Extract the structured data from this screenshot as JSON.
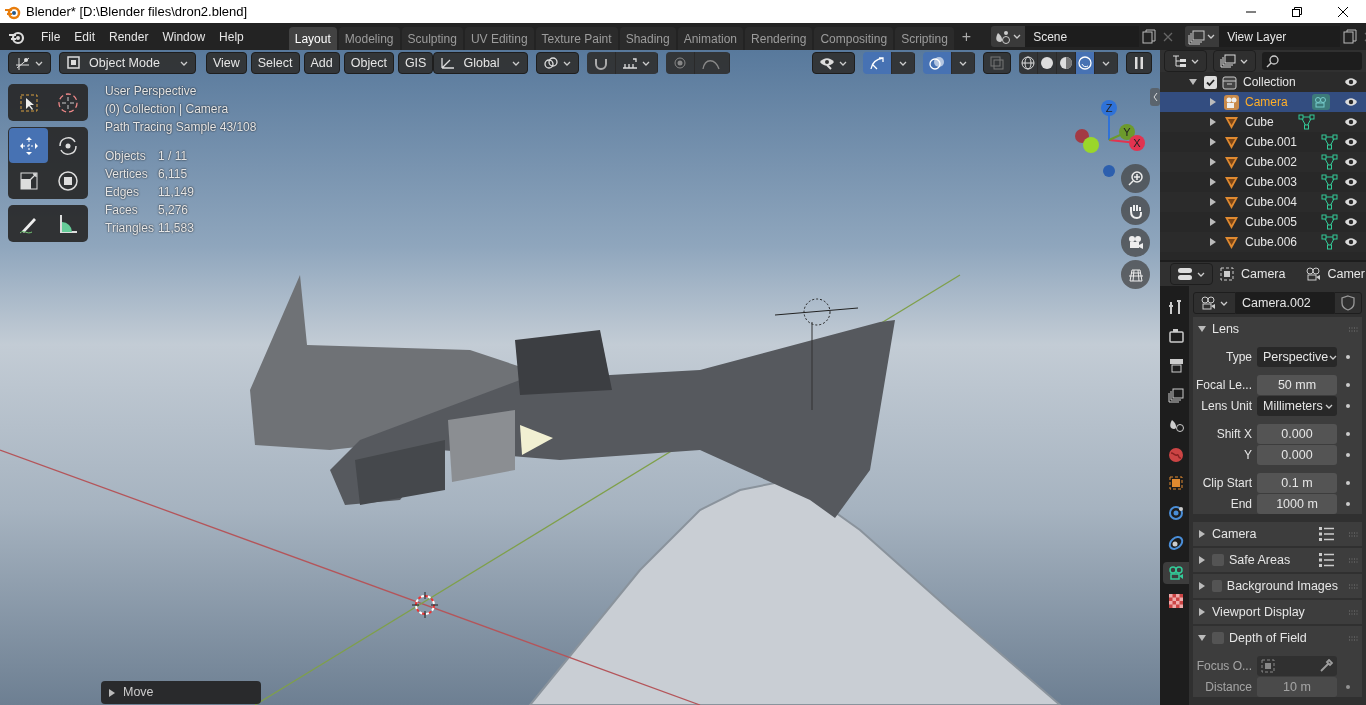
{
  "window": {
    "title": "Blender* [D:\\Blender files\\dron2.blend]"
  },
  "menu": [
    "File",
    "Edit",
    "Render",
    "Window",
    "Help"
  ],
  "workspaces": [
    {
      "label": "Layout",
      "selected": true
    },
    {
      "label": "Modeling",
      "selected": false
    },
    {
      "label": "Sculpting",
      "selected": false
    },
    {
      "label": "UV Editing",
      "selected": false
    },
    {
      "label": "Texture Paint",
      "selected": false
    },
    {
      "label": "Shading",
      "selected": false
    },
    {
      "label": "Animation",
      "selected": false
    },
    {
      "label": "Rendering",
      "selected": false
    },
    {
      "label": "Compositing",
      "selected": false
    },
    {
      "label": "Scripting",
      "selected": false
    }
  ],
  "add_workspace": "+",
  "scene": "Scene",
  "view_layer": "View Layer",
  "viewport": {
    "mode": "Object Mode",
    "menus": [
      "View",
      "Select",
      "Add",
      "Object",
      "GIS"
    ],
    "orientation": "Global",
    "snapping_on": false,
    "proportional_on": false,
    "gizmos_on": true,
    "overlays_on": true,
    "xray_on": false,
    "shading": [
      {
        "kind": "wireframe",
        "selected": false
      },
      {
        "kind": "solid",
        "selected": false
      },
      {
        "kind": "material",
        "selected": false
      },
      {
        "kind": "rendered",
        "selected": true
      }
    ],
    "tool_groups": [
      [
        {
          "kind": "select_box",
          "selected": false
        },
        {
          "kind": "cursor",
          "selected": false
        }
      ],
      [
        {
          "kind": "move",
          "selected": true
        },
        {
          "kind": "rotate",
          "selected": false
        },
        {
          "kind": "scale",
          "selected": false
        },
        {
          "kind": "transform",
          "selected": false
        }
      ],
      [
        {
          "kind": "annotate",
          "selected": false
        },
        {
          "kind": "measure",
          "selected": false
        }
      ]
    ],
    "info": [
      "User Perspective",
      "(0) Collection | Camera",
      "Path Tracing Sample 43/108"
    ],
    "stats": [
      {
        "label": "Objects",
        "value": "1 / 11"
      },
      {
        "label": "Vertices",
        "value": "6,115"
      },
      {
        "label": "Edges",
        "value": "11,149"
      },
      {
        "label": "Faces",
        "value": "5,276"
      },
      {
        "label": "Triangles",
        "value": "11,583"
      }
    ],
    "axes": [
      {
        "label": "Z",
        "color": "#2f72d8"
      },
      {
        "label": "Y",
        "color": "#6c9a2c"
      },
      {
        "label": "X",
        "color": "#e23350"
      }
    ],
    "last_operator": {
      "label": "Move",
      "expanded": false
    }
  },
  "outliner": {
    "items": [
      {
        "name": "Collection",
        "kind": "collection",
        "checked": true,
        "expanded": true,
        "selected": false,
        "children": [
          {
            "name": "Camera",
            "kind": "camera",
            "selected": true,
            "expanded": false
          },
          {
            "name": "Cube",
            "kind": "mesh",
            "selected": false,
            "expanded": false
          },
          {
            "name": "Cube.001",
            "kind": "mesh",
            "selected": false,
            "expanded": false
          },
          {
            "name": "Cube.002",
            "kind": "mesh",
            "selected": false,
            "expanded": false
          },
          {
            "name": "Cube.003",
            "kind": "mesh",
            "selected": false,
            "expanded": false
          },
          {
            "name": "Cube.004",
            "kind": "mesh",
            "selected": false,
            "expanded": false
          },
          {
            "name": "Cube.005",
            "kind": "mesh",
            "selected": false,
            "expanded": false
          },
          {
            "name": "Cube.006",
            "kind": "mesh",
            "selected": false,
            "expanded": false
          }
        ]
      }
    ]
  },
  "properties": {
    "tab_groups": [
      [
        {
          "kind": "tool",
          "selected": false
        }
      ],
      [
        {
          "kind": "render",
          "selected": false
        },
        {
          "kind": "output",
          "selected": false
        },
        {
          "kind": "view_layer",
          "selected": false
        },
        {
          "kind": "scene",
          "selected": false
        },
        {
          "kind": "world",
          "selected": false
        }
      ],
      [
        {
          "kind": "object",
          "selected": false
        },
        {
          "kind": "physics",
          "selected": false
        },
        {
          "kind": "constraints",
          "selected": false
        },
        {
          "kind": "data",
          "selected": true
        }
      ],
      [
        {
          "kind": "texture",
          "selected": false
        }
      ]
    ],
    "context": [
      "Camera",
      "Camer"
    ],
    "datablock": "Camera.002",
    "panels": [
      {
        "title": "Lens",
        "kind": "plain",
        "expanded": true,
        "presets": false,
        "groups": [
          [
            {
              "label": "Type",
              "value": "Perspective",
              "kind": "dropdown"
            }
          ],
          [
            {
              "label": "Focal Le...",
              "value": "50 mm",
              "kind": "number"
            },
            {
              "label": "Lens Unit",
              "value": "Millimeters",
              "kind": "dropdown"
            }
          ],
          [
            {
              "label": "Shift X",
              "value": "0.000",
              "kind": "number"
            },
            {
              "label": "Y",
              "value": "0.000",
              "kind": "number"
            }
          ],
          [
            {
              "label": "Clip Start",
              "value": "0.1 m",
              "kind": "number"
            },
            {
              "label": "End",
              "value": "1000 m",
              "kind": "number"
            }
          ]
        ]
      },
      {
        "title": "Camera",
        "kind": "plain",
        "expanded": false,
        "presets": true
      },
      {
        "title": "Safe Areas",
        "kind": "toggle",
        "checked": false,
        "expanded": false,
        "presets": true
      },
      {
        "title": "Background Images",
        "kind": "toggle",
        "checked": false,
        "expanded": false,
        "presets": false
      },
      {
        "title": "Viewport Display",
        "kind": "plain",
        "expanded": false,
        "presets": false
      },
      {
        "title": "Depth of Field",
        "kind": "toggle",
        "checked": false,
        "expanded": true,
        "presets": false,
        "groups": [
          [
            {
              "label": "Focus O...",
              "kind": "object"
            },
            {
              "label": "Distance",
              "value": "10 m",
              "kind": "number"
            }
          ]
        ]
      }
    ]
  }
}
